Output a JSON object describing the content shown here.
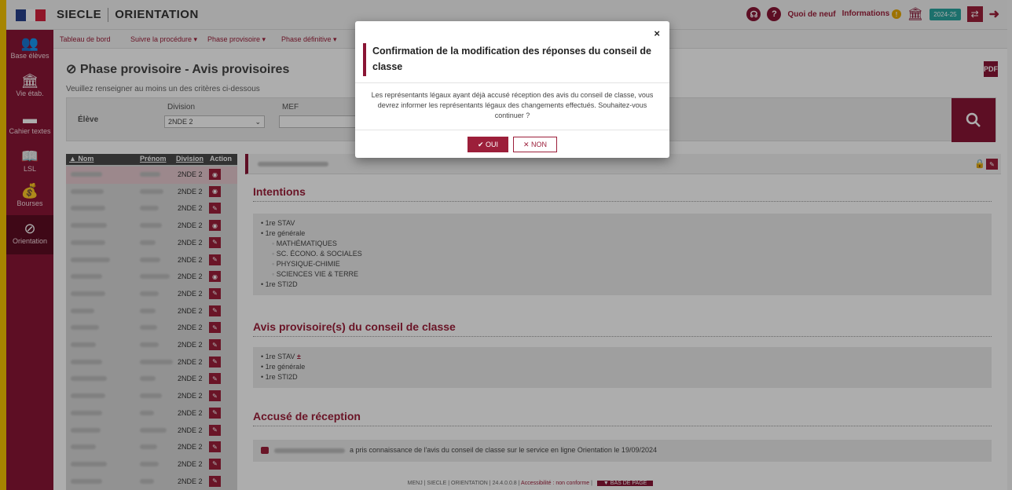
{
  "app": {
    "name": "SIECLE",
    "module": "ORIENTATION"
  },
  "topbar": {
    "quoi_de_neuf": "Quoi de neuf",
    "informations": "Informations",
    "info_badge": "!",
    "year": "2024-25"
  },
  "sidebar": {
    "items": [
      {
        "label": "Base élèves",
        "icon": "students-icon"
      },
      {
        "label": "Vie étab.",
        "icon": "institution-icon"
      },
      {
        "label": "Cahier textes",
        "icon": "notebook-icon"
      },
      {
        "label": "LSL",
        "icon": "book-icon"
      },
      {
        "label": "Bourses",
        "icon": "money-bag-icon"
      },
      {
        "label": "Orientation",
        "icon": "compass-icon"
      }
    ]
  },
  "subnav": {
    "items": [
      "Tableau de bord",
      "Suivre la procédure ▾",
      "Phase provisoire ▾",
      "Phase définitive ▾"
    ]
  },
  "page": {
    "title": "Phase provisoire - Avis provisoires",
    "hint": "Veuillez renseigner au moins un des critères ci-dessous",
    "pdf_label": "PDF"
  },
  "filter": {
    "eleve_label": "Élève",
    "division_label": "Division",
    "division_value": "2NDE 2",
    "mef_label": "MEF",
    "mef_value": ""
  },
  "students": {
    "headers": {
      "nom": "▲ Nom",
      "prenom": "Prénom",
      "division": "Division",
      "action": "Action"
    },
    "rows": [
      {
        "division": "2NDE 2",
        "action": "eye"
      },
      {
        "division": "2NDE 2",
        "action": "eye"
      },
      {
        "division": "2NDE 2",
        "action": "edit"
      },
      {
        "division": "2NDE 2",
        "action": "eye"
      },
      {
        "division": "2NDE 2",
        "action": "edit"
      },
      {
        "division": "2NDE 2",
        "action": "edit"
      },
      {
        "division": "2NDE 2",
        "action": "eye"
      },
      {
        "division": "2NDE 2",
        "action": "edit"
      },
      {
        "division": "2NDE 2",
        "action": "edit"
      },
      {
        "division": "2NDE 2",
        "action": "edit"
      },
      {
        "division": "2NDE 2",
        "action": "edit"
      },
      {
        "division": "2NDE 2",
        "action": "edit"
      },
      {
        "division": "2NDE 2",
        "action": "edit"
      },
      {
        "division": "2NDE 2",
        "action": "edit"
      },
      {
        "division": "2NDE 2",
        "action": "edit"
      },
      {
        "division": "2NDE 2",
        "action": "edit"
      },
      {
        "division": "2NDE 2",
        "action": "edit"
      },
      {
        "division": "2NDE 2",
        "action": "edit"
      },
      {
        "division": "2NDE 2",
        "action": "edit"
      }
    ]
  },
  "detail": {
    "intentions_title": "Intentions",
    "intentions": {
      "stav": "1re STAV",
      "generale": "1re générale",
      "specialites": [
        "MATHÉMATIQUES",
        "SC. ÉCONO. & SOCIALES",
        "PHYSIQUE-CHIMIE",
        "SCIENCES VIE & TERRE"
      ],
      "sti2d": "1re STI2D"
    },
    "avis_title": "Avis provisoire(s) du conseil de classe",
    "avis": {
      "stav": "1re STAV",
      "stav_mark": "±",
      "generale": "1re générale",
      "sti2d": "1re STI2D"
    },
    "accuse_title": "Accusé de réception",
    "accuse_text": "a pris connaissance de l'avis du conseil de classe sur le service en ligne Orientation le 19/09/2024"
  },
  "footer": {
    "items": [
      "MENJ",
      "SIECLE",
      "ORIENTATION",
      "24.4.0.0.8",
      "Accessibilité : non conforme"
    ],
    "top_label": "▼ BAS DE PAGE"
  },
  "modal": {
    "title": "Confirmation de la modification des réponses du conseil de classe",
    "body": "Les représentants légaux ayant déjà accusé réception des avis du conseil de classe, vous devrez informer les représentants légaux des changements effectués. Souhaitez-vous continuer ?",
    "oui_label": "OUI",
    "non_label": "NON",
    "close": "×"
  },
  "colors": {
    "brand": "#8a1535",
    "accent": "#9c1f3a",
    "sidebar": "#8a1535",
    "highlight": "#f5c400"
  }
}
